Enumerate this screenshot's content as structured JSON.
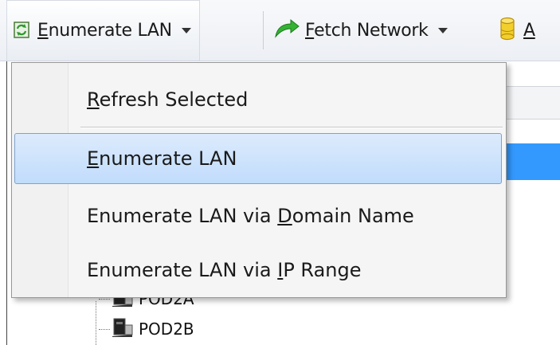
{
  "toolbar": {
    "enumerate": {
      "pre": "",
      "mnemonic": "E",
      "post": "numerate LAN"
    },
    "fetch": {
      "pre": "",
      "mnemonic": "F",
      "post": "etch Network"
    },
    "third": {
      "pre": "",
      "mnemonic": "A",
      "post": ""
    }
  },
  "menu": {
    "refresh": {
      "pre": "",
      "mnemonic": "R",
      "post": "efresh Selected"
    },
    "enumerate": {
      "pre": "",
      "mnemonic": "E",
      "post": "numerate LAN"
    },
    "domain": {
      "pre": "Enumerate LAN via ",
      "mnemonic": "D",
      "post": "omain Name"
    },
    "ip": {
      "pre": "Enumerate LAN via ",
      "mnemonic": "I",
      "post": "P Range"
    }
  },
  "tree": {
    "row1": "POD2A",
    "row2": "POD2B"
  },
  "colors": {
    "selection": "#3399ff",
    "menu_highlight": "#c1dcfc"
  }
}
